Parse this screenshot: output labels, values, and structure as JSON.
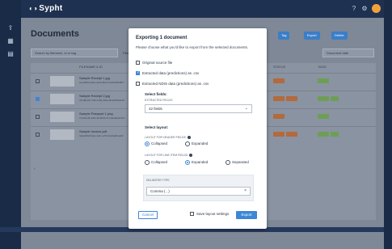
{
  "app": {
    "name": "Sypht"
  },
  "page": {
    "title": "Documents"
  },
  "toolbar": {
    "buttons": [
      "Smart Split",
      "Tag",
      "Export",
      "Delete"
    ],
    "search_placeholder": "Search by filename, id or tag",
    "filter_label": "Filters",
    "sort_label": "Document date"
  },
  "table": {
    "headers": [
      "",
      "FILENAME & ID",
      "",
      "STATUS",
      "TAGS",
      ""
    ],
    "rows": [
      {
        "title": "Sample Receipt 1.jpg",
        "sub": "ae1a28fc-6e6a-4e0a-8bb1-b6e5ab5b8fb7"
      },
      {
        "title": "Sample Receipt 2.jpg",
        "sub": "c51d8e33-7c9b-4c8a-9a0a-6b3e5f5aa102"
      },
      {
        "title": "Sample Passport 1.png",
        "sub": "71e5de49-2c8c-4bd8-91d7-1bde8ab2c6cb"
      },
      {
        "title": "Sample Invoice.pdf",
        "sub": "0a3e9f62-54a1-4d1c-a7f4-6e15a8c1a2f2"
      }
    ]
  },
  "modal": {
    "title": "Exporting 1 document",
    "description": "Please choose what you'd like to export from the selected documents.",
    "options": [
      {
        "label": "Original source file",
        "checked": false
      },
      {
        "label": "Extracted data (predictions) as .csv",
        "checked": true
      },
      {
        "label": "Extracted NDIS data (predictions) as .csv",
        "checked": false
      }
    ],
    "select_fields": {
      "heading": "Select fields:",
      "label": "EXTRACTED FIELDS",
      "value": "42 fields"
    },
    "select_layout": {
      "heading": "Select layout:",
      "header_label": "LAYOUT FOR HEADER FIELDS",
      "header_options": [
        "Collapsed",
        "Expanded"
      ],
      "header_selected": "Collapsed",
      "line_label": "LAYOUT FOR LINE ITEM FIELDS",
      "line_options": [
        "Collapsed",
        "Expanded",
        "Separated"
      ],
      "line_selected": "Expanded"
    },
    "delimiter": {
      "label": "DELIMITER TYPE",
      "value": "Comma ( , )"
    },
    "footer": {
      "cancel": "Cancel",
      "save_layout": "Save layout settings",
      "export": "Export"
    }
  }
}
